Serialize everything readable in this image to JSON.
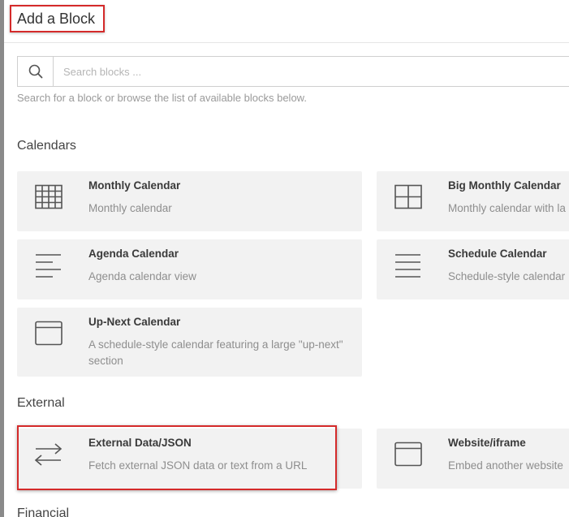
{
  "header": {
    "title": "Add a Block"
  },
  "search": {
    "placeholder": "Search blocks ...",
    "help": "Search for a block or browse the list of available blocks below."
  },
  "sections": [
    {
      "title": "Calendars",
      "blocks": [
        {
          "title": "Monthly Calendar",
          "desc": "Monthly calendar",
          "icon": "monthly-grid-icon"
        },
        {
          "title": "Big Monthly Calendar",
          "desc": "Monthly calendar with la",
          "icon": "big-grid-icon"
        },
        {
          "title": "Agenda Calendar",
          "desc": "Agenda calendar view",
          "icon": "agenda-lines-icon"
        },
        {
          "title": "Schedule Calendar",
          "desc": "Schedule-style calendar",
          "icon": "schedule-lines-icon"
        },
        {
          "title": "Up-Next Calendar",
          "desc": "A schedule-style calendar featuring a large \"up-next\" section",
          "icon": "window-icon"
        }
      ]
    },
    {
      "title": "External",
      "blocks": [
        {
          "title": "External Data/JSON",
          "desc": "Fetch external JSON data or text from a URL",
          "icon": "exchange-arrows-icon"
        },
        {
          "title": "Website/iframe",
          "desc": "Embed another website",
          "icon": "window-icon"
        }
      ]
    },
    {
      "title": "Financial"
    }
  ],
  "colors": {
    "highlight": "#d42a2a",
    "card_bg": "#f2f2f2",
    "icon": "#555555"
  }
}
